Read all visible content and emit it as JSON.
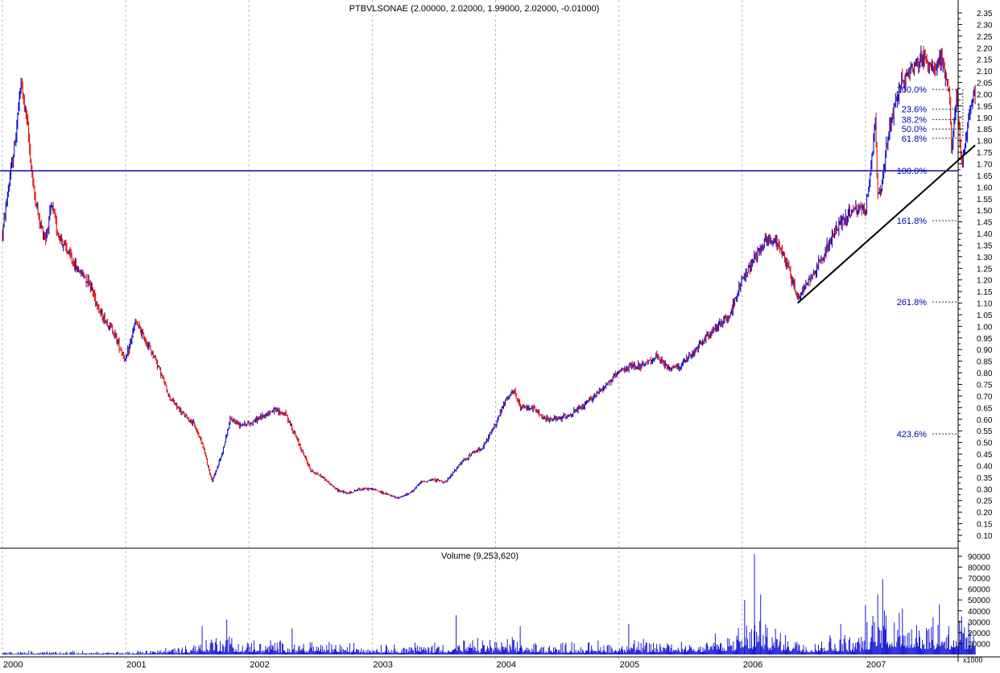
{
  "chart_data": [
    {
      "type": "ohlc",
      "title": "PTBVLSONAE (2.00000, 2.02000, 1.99000, 2.02000, -0.01000)",
      "xlabel": "",
      "ylabel": "",
      "x_tick_labels": [
        "2000",
        "2001",
        "2002",
        "2003",
        "2004",
        "2005",
        "2006",
        "2007"
      ],
      "ylim": [
        0.05,
        2.35
      ],
      "y_tick_labels": [
        "2.35",
        "2.30",
        "2.25",
        "2.20",
        "2.15",
        "2.10",
        "2.05",
        "2.00",
        "1.95",
        "1.90",
        "1.85",
        "1.80",
        "1.75",
        "1.70",
        "1.65",
        "1.60",
        "1.55",
        "1.50",
        "1.45",
        "1.40",
        "1.35",
        "1.30",
        "1.25",
        "1.20",
        "1.15",
        "1.10",
        "1.05",
        "1.00",
        "0.95",
        "0.90",
        "0.85",
        "0.80",
        "0.75",
        "0.70",
        "0.65",
        "0.60",
        "0.55",
        "0.50",
        "0.45",
        "0.40",
        "0.35",
        "0.30",
        "0.25",
        "0.20",
        "0.15",
        "0.10"
      ],
      "grid": "vertical dotted at year boundaries",
      "colors": {
        "up": "#1010cc",
        "down": "#dd1111",
        "fib": "#0000aa",
        "line": "#000000"
      },
      "price_path": [
        {
          "x": 2000.0,
          "y": 1.4
        },
        {
          "x": 2000.05,
          "y": 1.6
        },
        {
          "x": 2000.1,
          "y": 1.78
        },
        {
          "x": 2000.15,
          "y": 2.05
        },
        {
          "x": 2000.2,
          "y": 1.88
        },
        {
          "x": 2000.25,
          "y": 1.6
        },
        {
          "x": 2000.3,
          "y": 1.45
        },
        {
          "x": 2000.35,
          "y": 1.38
        },
        {
          "x": 2000.4,
          "y": 1.52
        },
        {
          "x": 2000.45,
          "y": 1.4
        },
        {
          "x": 2000.5,
          "y": 1.35
        },
        {
          "x": 2000.6,
          "y": 1.25
        },
        {
          "x": 2000.7,
          "y": 1.2
        },
        {
          "x": 2000.8,
          "y": 1.05
        },
        {
          "x": 2000.9,
          "y": 0.98
        },
        {
          "x": 2001.0,
          "y": 0.85
        },
        {
          "x": 2001.08,
          "y": 1.02
        },
        {
          "x": 2001.15,
          "y": 0.95
        },
        {
          "x": 2001.25,
          "y": 0.85
        },
        {
          "x": 2001.35,
          "y": 0.7
        },
        {
          "x": 2001.45,
          "y": 0.63
        },
        {
          "x": 2001.55,
          "y": 0.58
        },
        {
          "x": 2001.62,
          "y": 0.5
        },
        {
          "x": 2001.7,
          "y": 0.33
        },
        {
          "x": 2001.78,
          "y": 0.45
        },
        {
          "x": 2001.85,
          "y": 0.6
        },
        {
          "x": 2001.92,
          "y": 0.58
        },
        {
          "x": 2002.0,
          "y": 0.58
        },
        {
          "x": 2002.1,
          "y": 0.61
        },
        {
          "x": 2002.2,
          "y": 0.64
        },
        {
          "x": 2002.3,
          "y": 0.62
        },
        {
          "x": 2002.4,
          "y": 0.5
        },
        {
          "x": 2002.5,
          "y": 0.38
        },
        {
          "x": 2002.6,
          "y": 0.35
        },
        {
          "x": 2002.7,
          "y": 0.3
        },
        {
          "x": 2002.8,
          "y": 0.28
        },
        {
          "x": 2002.9,
          "y": 0.3
        },
        {
          "x": 2003.0,
          "y": 0.3
        },
        {
          "x": 2003.1,
          "y": 0.28
        },
        {
          "x": 2003.2,
          "y": 0.26
        },
        {
          "x": 2003.3,
          "y": 0.28
        },
        {
          "x": 2003.4,
          "y": 0.33
        },
        {
          "x": 2003.5,
          "y": 0.34
        },
        {
          "x": 2003.6,
          "y": 0.33
        },
        {
          "x": 2003.7,
          "y": 0.4
        },
        {
          "x": 2003.8,
          "y": 0.45
        },
        {
          "x": 2003.9,
          "y": 0.48
        },
        {
          "x": 2004.0,
          "y": 0.58
        },
        {
          "x": 2004.08,
          "y": 0.68
        },
        {
          "x": 2004.15,
          "y": 0.72
        },
        {
          "x": 2004.2,
          "y": 0.65
        },
        {
          "x": 2004.3,
          "y": 0.65
        },
        {
          "x": 2004.4,
          "y": 0.6
        },
        {
          "x": 2004.5,
          "y": 0.6
        },
        {
          "x": 2004.6,
          "y": 0.62
        },
        {
          "x": 2004.7,
          "y": 0.65
        },
        {
          "x": 2004.8,
          "y": 0.7
        },
        {
          "x": 2004.9,
          "y": 0.75
        },
        {
          "x": 2005.0,
          "y": 0.8
        },
        {
          "x": 2005.1,
          "y": 0.83
        },
        {
          "x": 2005.2,
          "y": 0.83
        },
        {
          "x": 2005.3,
          "y": 0.87
        },
        {
          "x": 2005.4,
          "y": 0.82
        },
        {
          "x": 2005.5,
          "y": 0.83
        },
        {
          "x": 2005.6,
          "y": 0.88
        },
        {
          "x": 2005.7,
          "y": 0.95
        },
        {
          "x": 2005.8,
          "y": 1.0
        },
        {
          "x": 2005.9,
          "y": 1.05
        },
        {
          "x": 2006.0,
          "y": 1.2
        },
        {
          "x": 2006.1,
          "y": 1.3
        },
        {
          "x": 2006.2,
          "y": 1.38
        },
        {
          "x": 2006.3,
          "y": 1.35
        },
        {
          "x": 2006.38,
          "y": 1.25
        },
        {
          "x": 2006.45,
          "y": 1.12
        },
        {
          "x": 2006.52,
          "y": 1.18
        },
        {
          "x": 2006.6,
          "y": 1.25
        },
        {
          "x": 2006.7,
          "y": 1.35
        },
        {
          "x": 2006.8,
          "y": 1.45
        },
        {
          "x": 2006.9,
          "y": 1.5
        },
        {
          "x": 2007.0,
          "y": 1.5
        },
        {
          "x": 2007.05,
          "y": 1.7
        },
        {
          "x": 2007.08,
          "y": 1.9
        },
        {
          "x": 2007.1,
          "y": 1.55
        },
        {
          "x": 2007.13,
          "y": 1.6
        },
        {
          "x": 2007.18,
          "y": 1.8
        },
        {
          "x": 2007.25,
          "y": 2.0
        },
        {
          "x": 2007.35,
          "y": 2.1
        },
        {
          "x": 2007.45,
          "y": 2.15
        },
        {
          "x": 2007.55,
          "y": 2.12
        },
        {
          "x": 2007.62,
          "y": 2.15
        },
        {
          "x": 2007.68,
          "y": 2.0
        },
        {
          "x": 2007.7,
          "y": 1.75
        },
        {
          "x": 2007.74,
          "y": 2.0
        },
        {
          "x": 2007.78,
          "y": 1.7
        },
        {
          "x": 2007.83,
          "y": 1.85
        },
        {
          "x": 2007.87,
          "y": 2.0
        },
        {
          "x": 2007.89,
          "y": 2.02
        }
      ],
      "horizontal_line": {
        "y": 1.67
      },
      "trend_line": {
        "start": {
          "x": 2006.45,
          "y": 1.1
        },
        "end": {
          "x": 2007.89,
          "y": 1.78
        }
      },
      "fibonacci_levels": [
        {
          "label": "100.0%",
          "y": 2.02
        },
        {
          "label": "23.6%",
          "y": 1.935
        },
        {
          "label": "38.2%",
          "y": 1.89
        },
        {
          "label": "50.0%",
          "y": 1.85
        },
        {
          "label": "61.8%",
          "y": 1.81
        },
        {
          "label": "100.0%",
          "y": 1.67
        },
        {
          "label": "161.8%",
          "y": 1.455
        },
        {
          "label": "261.8%",
          "y": 1.105
        },
        {
          "label": "423.6%",
          "y": 0.537
        }
      ]
    },
    {
      "type": "bar",
      "title": "Volume (9,253,620)",
      "unit_label": "x1000",
      "ylim": [
        0,
        95000
      ],
      "y_tick_labels": [
        "90000",
        "80000",
        "70000",
        "60000",
        "50000",
        "40000",
        "30000",
        "20000",
        "10000"
      ],
      "volume_profile": [
        {
          "x": 2000.0,
          "y": 2000
        },
        {
          "x": 2000.5,
          "y": 2000
        },
        {
          "x": 2001.0,
          "y": 1500
        },
        {
          "x": 2001.5,
          "y": 6000
        },
        {
          "x": 2001.75,
          "y": 12000
        },
        {
          "x": 2002.0,
          "y": 8000
        },
        {
          "x": 2002.5,
          "y": 8000
        },
        {
          "x": 2003.0,
          "y": 6000
        },
        {
          "x": 2003.5,
          "y": 7000
        },
        {
          "x": 2004.0,
          "y": 9000
        },
        {
          "x": 2004.5,
          "y": 7000
        },
        {
          "x": 2005.0,
          "y": 8000
        },
        {
          "x": 2005.5,
          "y": 9000
        },
        {
          "x": 2006.0,
          "y": 14000
        },
        {
          "x": 2006.1,
          "y": 22000
        },
        {
          "x": 2006.5,
          "y": 9000
        },
        {
          "x": 2007.0,
          "y": 14000
        },
        {
          "x": 2007.1,
          "y": 30000
        },
        {
          "x": 2007.5,
          "y": 22000
        },
        {
          "x": 2007.89,
          "y": 18000
        }
      ],
      "spikes": [
        {
          "x": 2001.62,
          "y": 26000
        },
        {
          "x": 2001.82,
          "y": 32000
        },
        {
          "x": 2002.35,
          "y": 24000
        },
        {
          "x": 2003.68,
          "y": 36000
        },
        {
          "x": 2004.2,
          "y": 26000
        },
        {
          "x": 2005.08,
          "y": 28000
        },
        {
          "x": 2006.02,
          "y": 50000
        },
        {
          "x": 2006.1,
          "y": 92000
        },
        {
          "x": 2006.15,
          "y": 55000
        },
        {
          "x": 2006.8,
          "y": 28000
        },
        {
          "x": 2007.0,
          "y": 45000
        },
        {
          "x": 2007.1,
          "y": 55000
        },
        {
          "x": 2007.14,
          "y": 69000
        },
        {
          "x": 2007.3,
          "y": 42000
        },
        {
          "x": 2007.6,
          "y": 46000
        },
        {
          "x": 2007.78,
          "y": 35000
        }
      ]
    }
  ]
}
